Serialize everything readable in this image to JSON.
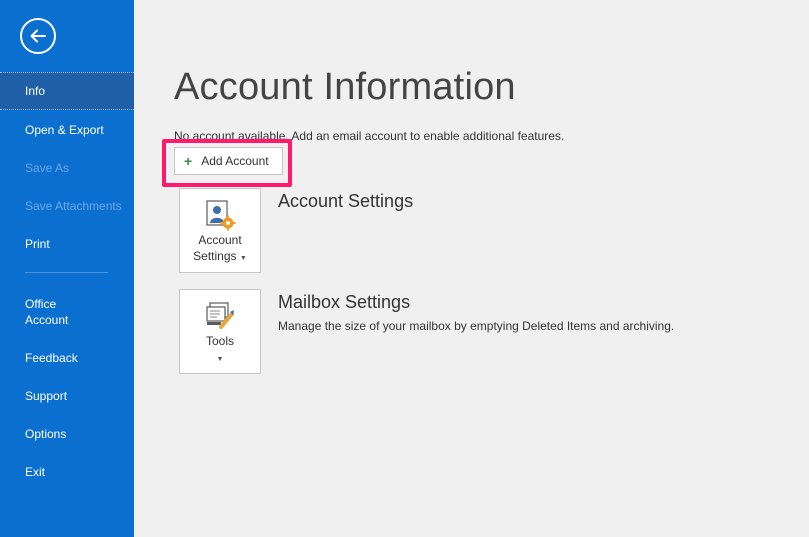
{
  "sidebar": {
    "back_icon": "back-arrow-icon",
    "items": [
      {
        "label": "Info",
        "state": "active"
      },
      {
        "label": "Open & Export",
        "state": "enabled"
      },
      {
        "label": "Save As",
        "state": "disabled"
      },
      {
        "label": "Save Attachments",
        "state": "disabled"
      },
      {
        "label": "Print",
        "state": "enabled"
      },
      {
        "label": "Office\nAccount",
        "line1": "Office",
        "line2": "Account",
        "state": "enabled"
      },
      {
        "label": "Feedback",
        "state": "enabled"
      },
      {
        "label": "Support",
        "state": "enabled"
      },
      {
        "label": "Options",
        "state": "enabled"
      },
      {
        "label": "Exit",
        "state": "enabled"
      }
    ]
  },
  "main": {
    "title": "Account Information",
    "info_text": "No account available. Add an email account to enable additional features.",
    "add_account": {
      "label": "Add Account",
      "icon": "plus-icon"
    },
    "account_settings": {
      "tile_line1": "Account",
      "tile_line2": "Settings",
      "icon": "account-settings-icon",
      "title": "Account Settings"
    },
    "mailbox_settings": {
      "tile_label": "Tools",
      "icon": "tools-icon",
      "title": "Mailbox Settings",
      "description": "Manage the size of your mailbox by emptying Deleted Items and archiving."
    }
  },
  "colors": {
    "sidebar_bg": "#0a6fcf",
    "sidebar_active": "#1e5fa8",
    "highlight": "#ff1a6e",
    "background": "#f0f0f0"
  }
}
